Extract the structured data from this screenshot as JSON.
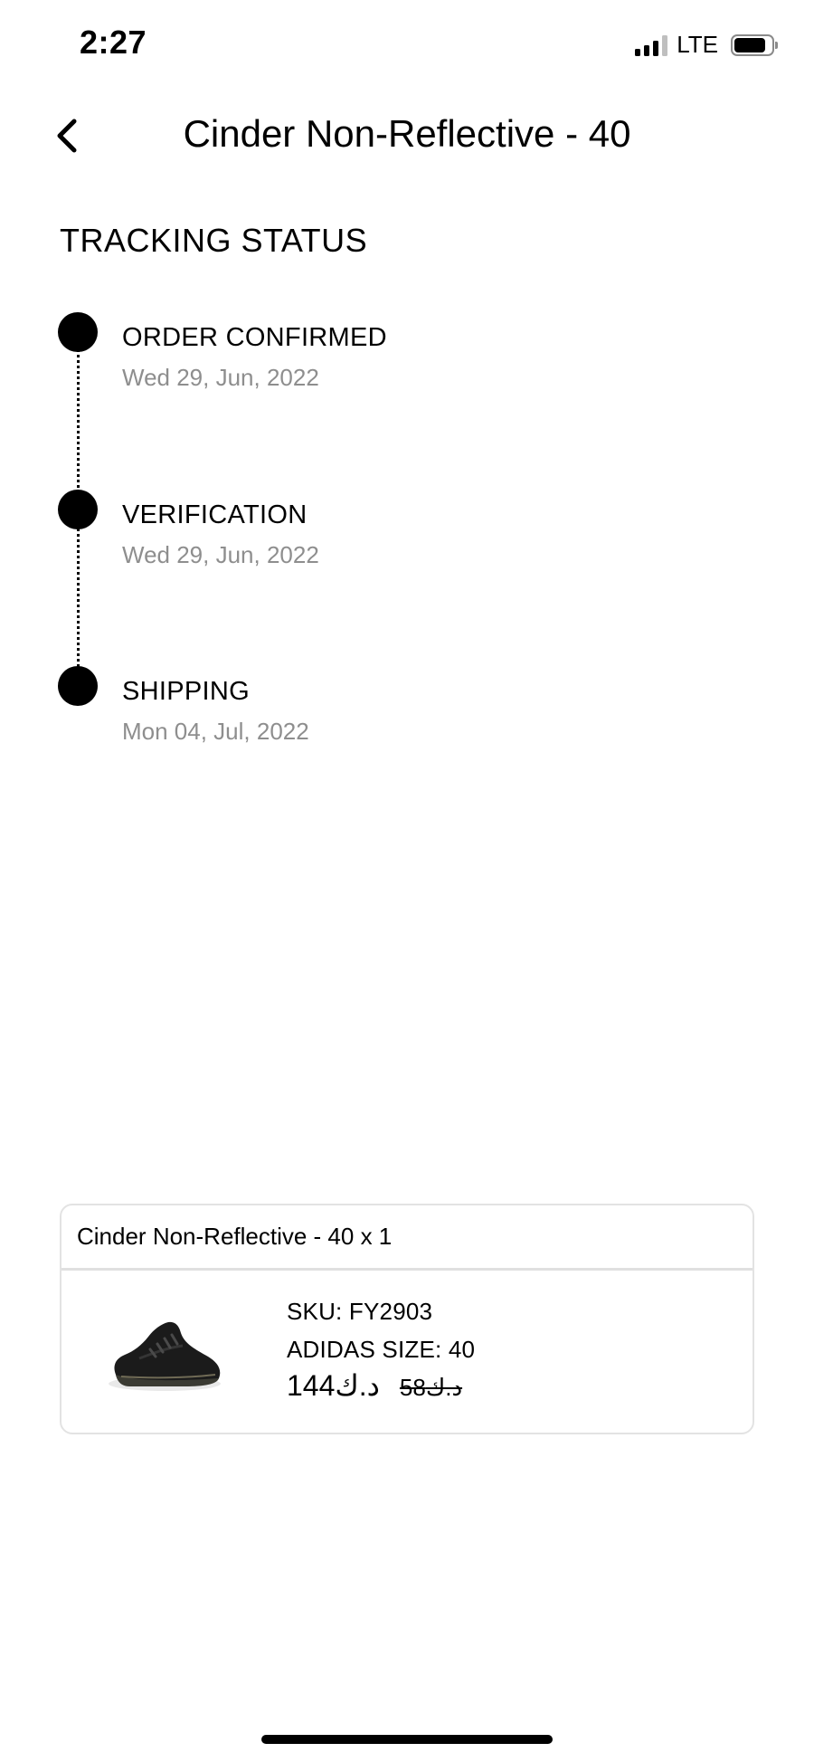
{
  "status_bar": {
    "time": "2:27",
    "network": "LTE",
    "signal_icon": "cellular-signal-icon",
    "battery_icon": "battery-icon"
  },
  "header": {
    "back_icon": "chevron-left-icon",
    "title": "Cinder Non-Reflective - 40"
  },
  "tracking": {
    "section_title": "TRACKING STATUS",
    "steps": [
      {
        "title": "ORDER CONFIRMED",
        "date": "Wed 29, Jun, 2022"
      },
      {
        "title": "VERIFICATION",
        "date": "Wed 29, Jun, 2022"
      },
      {
        "title": "SHIPPING",
        "date": "Mon 04, Jul, 2022"
      }
    ]
  },
  "order": {
    "header": "Cinder Non-Reflective - 40 x 1",
    "product_image_icon": "sneaker-image",
    "sku": "SKU: FY2903",
    "size": "ADIDAS SIZE: 40",
    "price_current": "144د.ك",
    "price_original": "58د.ك"
  },
  "colors": {
    "text": "#000000",
    "muted_text": "#8e8e8e",
    "border": "#e3e3e3",
    "background": "#ffffff"
  }
}
